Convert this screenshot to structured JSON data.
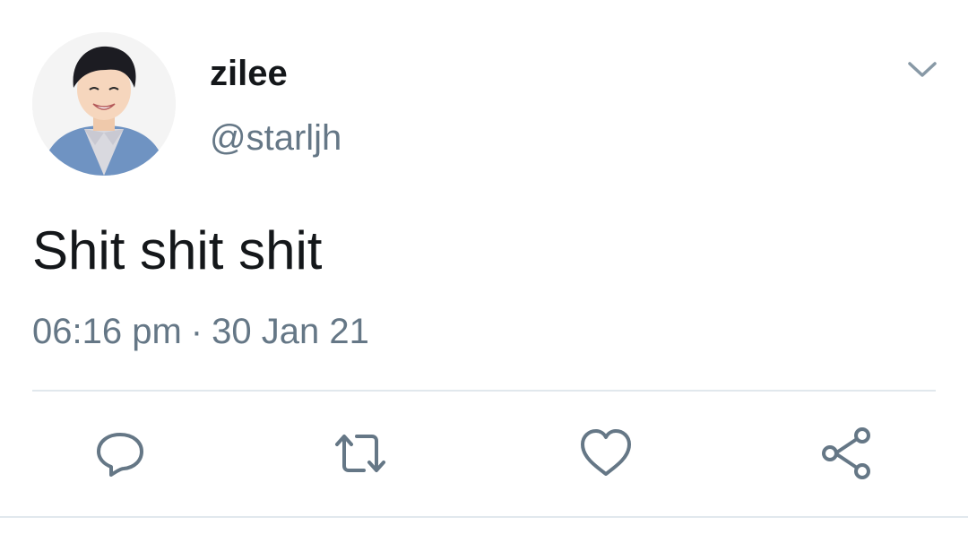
{
  "user": {
    "display_name": "zilee",
    "handle": "@starljh"
  },
  "tweet": {
    "text": "Shit shit shit",
    "time": "06:16 pm",
    "separator": "·",
    "date": "30 Jan 21"
  },
  "actions": [
    "reply",
    "retweet",
    "like",
    "share"
  ],
  "icons": {
    "menu": "chevron-down-icon",
    "reply": "speech-bubble-icon",
    "retweet": "retweet-arrows-icon",
    "like": "heart-icon",
    "share": "share-nodes-icon"
  },
  "colors": {
    "text_primary": "#14171a",
    "text_secondary": "#657786",
    "icon": "#657786",
    "divider": "#e1e8ed"
  }
}
